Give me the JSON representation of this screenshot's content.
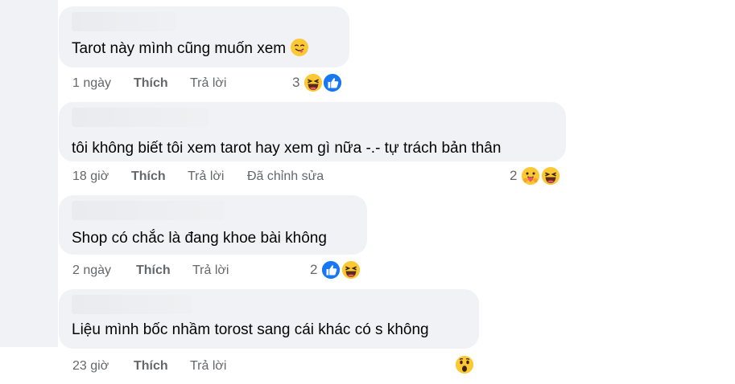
{
  "comments": [
    {
      "text": "Tarot này mình cũng muốn xem",
      "time": "1 ngày",
      "like": "Thích",
      "reply": "Trả lời",
      "edited": "",
      "reaction_count": "3",
      "reactions": [
        "haha-icon",
        "like-icon"
      ],
      "inline_emoji": "yum-face-icon"
    },
    {
      "text": "tôi không biết tôi xem tarot hay xem gì nữa -.- tự trách bản thân",
      "time": "18 giờ",
      "like": "Thích",
      "reply": "Trả lời",
      "edited": "Đã chỉnh sửa",
      "reaction_count": "2",
      "reactions": [
        "care-icon",
        "haha-icon"
      ]
    },
    {
      "text": "Shop có chắc là đang khoe bài không",
      "time": "2 ngày",
      "like": "Thích",
      "reply": "Trả lời",
      "edited": "",
      "reaction_count": "2",
      "reactions": [
        "like-icon",
        "haha-icon"
      ]
    },
    {
      "text": "Liệu mình bốc nhầm torost sang cái khác có s không",
      "time": "23 giờ",
      "like": "Thích",
      "reply": "Trả lời",
      "edited": "",
      "reaction_count": "",
      "reactions": [
        "wow-icon"
      ]
    }
  ],
  "colors": {
    "bubble_bg": "#f0f2f5",
    "meta_text": "#65676b",
    "like_blue": "#1877f2",
    "emoji_yellow": "#fcc934"
  }
}
